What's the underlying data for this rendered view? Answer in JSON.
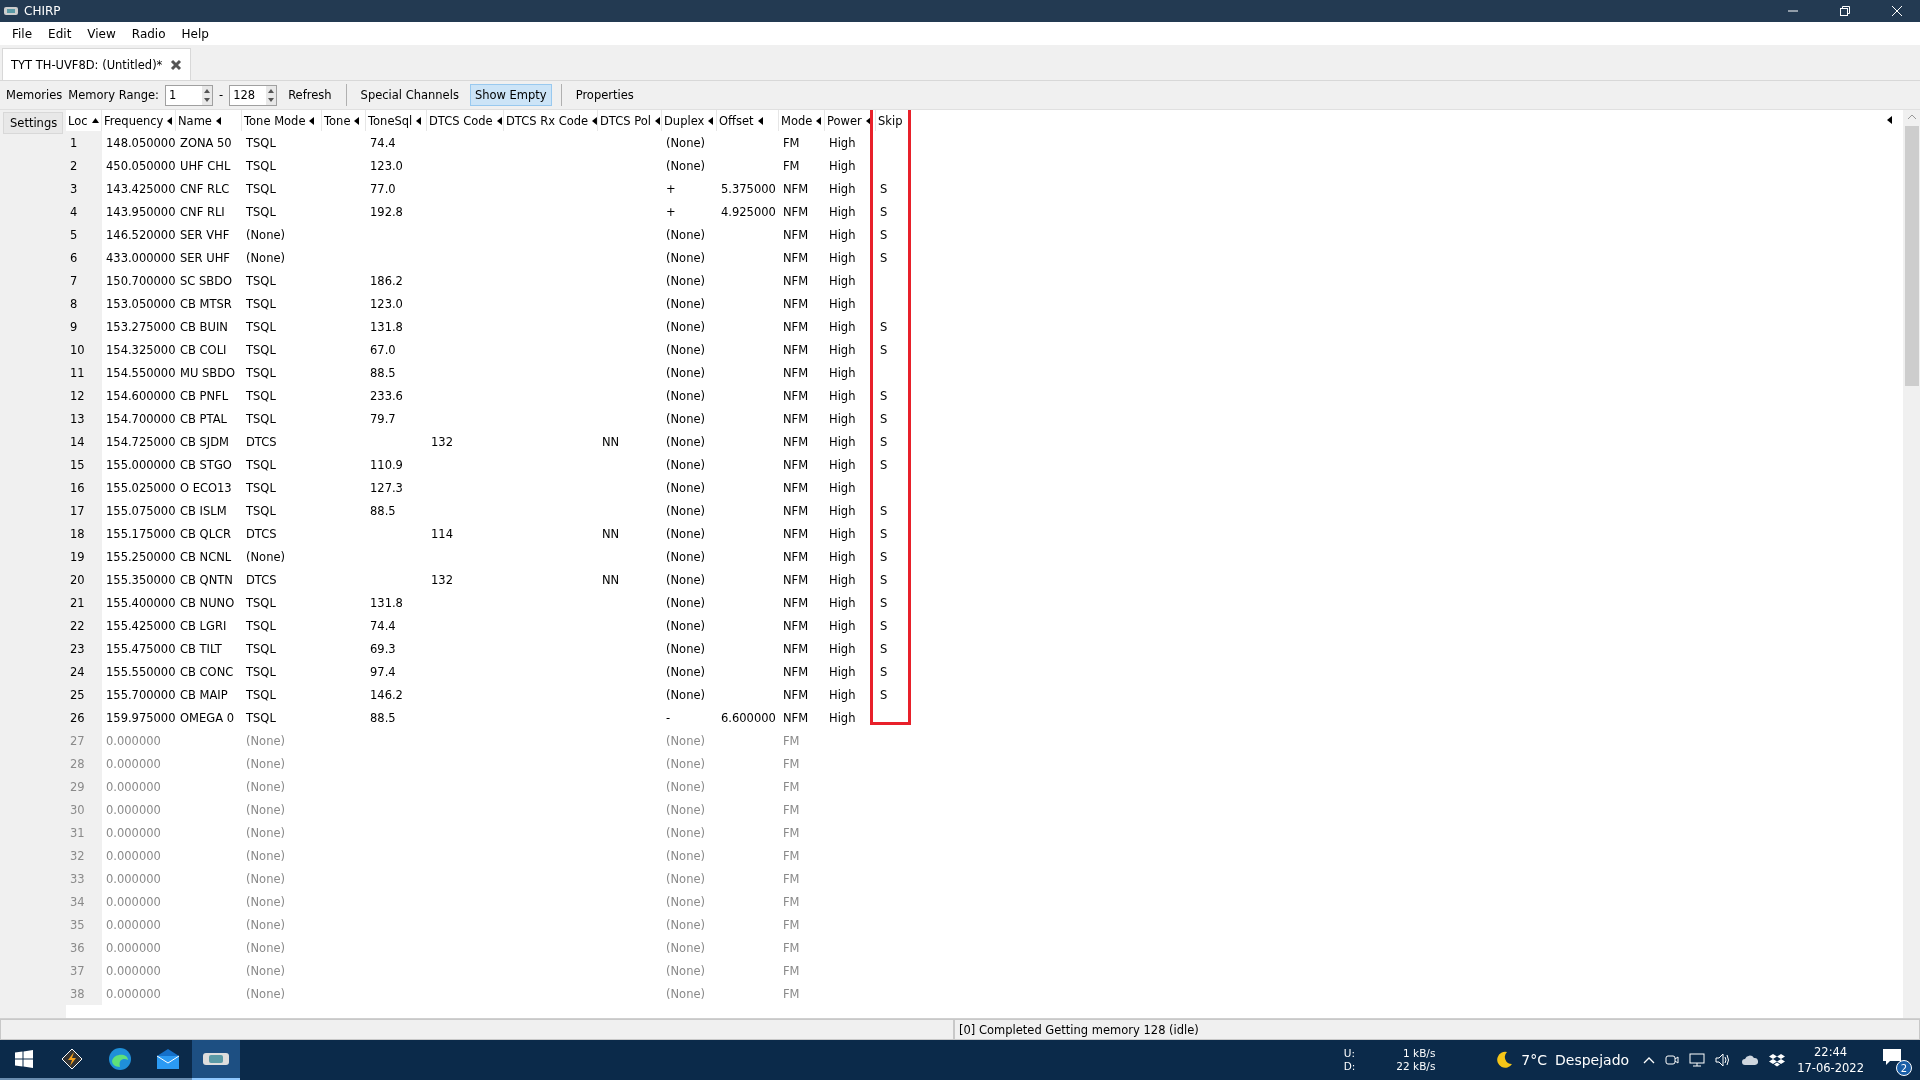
{
  "window": {
    "title": "CHIRP"
  },
  "menu": [
    "File",
    "Edit",
    "View",
    "Radio",
    "Help"
  ],
  "tabs": [
    {
      "label": "TYT TH-UVF8D: (Untitled)*",
      "selected": true
    }
  ],
  "toolbar": {
    "memories_label": "Memories",
    "range_label": "Memory Range:",
    "range_start": "1",
    "range_separator": "-",
    "range_end": "128",
    "refresh": "Refresh",
    "special_channels": "Special Channels",
    "show_empty": {
      "label": "Show Empty",
      "on": true
    },
    "properties": "Properties"
  },
  "side_tabs": [
    {
      "label": "Settings",
      "selected": false
    }
  ],
  "table": {
    "columns": [
      {
        "label": "Loc",
        "sorted": true,
        "highlighted": false
      },
      {
        "label": "Frequency",
        "sorted": false,
        "highlighted": false
      },
      {
        "label": "Name",
        "sorted": false,
        "highlighted": false
      },
      {
        "label": "Tone Mode",
        "sorted": false,
        "highlighted": false
      },
      {
        "label": "Tone",
        "sorted": false,
        "highlighted": false
      },
      {
        "label": "ToneSql",
        "sorted": false,
        "highlighted": false
      },
      {
        "label": "DTCS Code",
        "sorted": false,
        "highlighted": false
      },
      {
        "label": "DTCS Rx Code",
        "sorted": false,
        "highlighted": false
      },
      {
        "label": "DTCS Pol",
        "sorted": false,
        "highlighted": false
      },
      {
        "label": "Duplex",
        "sorted": false,
        "highlighted": false
      },
      {
        "label": "Offset",
        "sorted": false,
        "highlighted": false
      },
      {
        "label": "Mode",
        "sorted": false,
        "highlighted": false
      },
      {
        "label": "Power",
        "sorted": false,
        "highlighted": false
      },
      {
        "label": "Skip",
        "highlighted": true
      }
    ],
    "rows": [
      {
        "empty": false,
        "cells": [
          "1",
          "148.050000",
          "ZONA 50",
          "TSQL",
          null,
          "74.4",
          null,
          null,
          null,
          "(None)",
          null,
          "FM",
          "High",
          null
        ]
      },
      {
        "empty": false,
        "cells": [
          "2",
          "450.050000",
          "UHF CHL",
          "TSQL",
          null,
          "123.0",
          null,
          null,
          null,
          "(None)",
          null,
          "FM",
          "High",
          null
        ]
      },
      {
        "empty": false,
        "cells": [
          "3",
          "143.425000",
          "CNF RLC",
          "TSQL",
          null,
          "77.0",
          null,
          null,
          null,
          "+",
          "5.375000",
          "NFM",
          "High",
          "S"
        ]
      },
      {
        "empty": false,
        "cells": [
          "4",
          "143.950000",
          "CNF RLI",
          "TSQL",
          null,
          "192.8",
          null,
          null,
          null,
          "+",
          "4.925000",
          "NFM",
          "High",
          "S"
        ]
      },
      {
        "empty": false,
        "cells": [
          "5",
          "146.520000",
          "SER VHF",
          "(None)",
          null,
          null,
          null,
          null,
          null,
          "(None)",
          null,
          "NFM",
          "High",
          "S"
        ]
      },
      {
        "empty": false,
        "cells": [
          "6",
          "433.000000",
          "SER UHF",
          "(None)",
          null,
          null,
          null,
          null,
          null,
          "(None)",
          null,
          "NFM",
          "High",
          "S"
        ]
      },
      {
        "empty": false,
        "cells": [
          "7",
          "150.700000",
          "SC SBDO",
          "TSQL",
          null,
          "186.2",
          null,
          null,
          null,
          "(None)",
          null,
          "NFM",
          "High",
          null
        ]
      },
      {
        "empty": false,
        "cells": [
          "8",
          "153.050000",
          "CB MTSR",
          "TSQL",
          null,
          "123.0",
          null,
          null,
          null,
          "(None)",
          null,
          "NFM",
          "High",
          null
        ]
      },
      {
        "empty": false,
        "cells": [
          "9",
          "153.275000",
          "CB BUIN",
          "TSQL",
          null,
          "131.8",
          null,
          null,
          null,
          "(None)",
          null,
          "NFM",
          "High",
          "S"
        ]
      },
      {
        "empty": false,
        "cells": [
          "10",
          "154.325000",
          "CB COLI",
          "TSQL",
          null,
          "67.0",
          null,
          null,
          null,
          "(None)",
          null,
          "NFM",
          "High",
          "S"
        ]
      },
      {
        "empty": false,
        "cells": [
          "11",
          "154.550000",
          "MU SBDO",
          "TSQL",
          null,
          "88.5",
          null,
          null,
          null,
          "(None)",
          null,
          "NFM",
          "High",
          null
        ]
      },
      {
        "empty": false,
        "cells": [
          "12",
          "154.600000",
          "CB PNFL",
          "TSQL",
          null,
          "233.6",
          null,
          null,
          null,
          "(None)",
          null,
          "NFM",
          "High",
          "S"
        ]
      },
      {
        "empty": false,
        "cells": [
          "13",
          "154.700000",
          "CB PTAL",
          "TSQL",
          null,
          "79.7",
          null,
          null,
          null,
          "(None)",
          null,
          "NFM",
          "High",
          "S"
        ]
      },
      {
        "empty": false,
        "cells": [
          "14",
          "154.725000",
          "CB SJDM",
          "DTCS",
          null,
          null,
          "132",
          null,
          "NN",
          "(None)",
          null,
          "NFM",
          "High",
          "S"
        ]
      },
      {
        "empty": false,
        "cells": [
          "15",
          "155.000000",
          "CB STGO",
          "TSQL",
          null,
          "110.9",
          null,
          null,
          null,
          "(None)",
          null,
          "NFM",
          "High",
          "S"
        ]
      },
      {
        "empty": false,
        "cells": [
          "16",
          "155.025000",
          "O ECO13",
          "TSQL",
          null,
          "127.3",
          null,
          null,
          null,
          "(None)",
          null,
          "NFM",
          "High",
          null
        ]
      },
      {
        "empty": false,
        "cells": [
          "17",
          "155.075000",
          "CB ISLM",
          "TSQL",
          null,
          "88.5",
          null,
          null,
          null,
          "(None)",
          null,
          "NFM",
          "High",
          "S"
        ]
      },
      {
        "empty": false,
        "cells": [
          "18",
          "155.175000",
          "CB QLCR",
          "DTCS",
          null,
          null,
          "114",
          null,
          "NN",
          "(None)",
          null,
          "NFM",
          "High",
          "S"
        ]
      },
      {
        "empty": false,
        "cells": [
          "19",
          "155.250000",
          "CB NCNL",
          "(None)",
          null,
          null,
          null,
          null,
          null,
          "(None)",
          null,
          "NFM",
          "High",
          "S"
        ]
      },
      {
        "empty": false,
        "cells": [
          "20",
          "155.350000",
          "CB QNTN",
          "DTCS",
          null,
          null,
          "132",
          null,
          "NN",
          "(None)",
          null,
          "NFM",
          "High",
          "S"
        ]
      },
      {
        "empty": false,
        "cells": [
          "21",
          "155.400000",
          "CB NUNO",
          "TSQL",
          null,
          "131.8",
          null,
          null,
          null,
          "(None)",
          null,
          "NFM",
          "High",
          "S"
        ]
      },
      {
        "empty": false,
        "cells": [
          "22",
          "155.425000",
          "CB LGRI",
          "TSQL",
          null,
          "74.4",
          null,
          null,
          null,
          "(None)",
          null,
          "NFM",
          "High",
          "S"
        ]
      },
      {
        "empty": false,
        "cells": [
          "23",
          "155.475000",
          "CB TILT",
          "TSQL",
          null,
          "69.3",
          null,
          null,
          null,
          "(None)",
          null,
          "NFM",
          "High",
          "S"
        ]
      },
      {
        "empty": false,
        "cells": [
          "24",
          "155.550000",
          "CB CONC",
          "TSQL",
          null,
          "97.4",
          null,
          null,
          null,
          "(None)",
          null,
          "NFM",
          "High",
          "S"
        ]
      },
      {
        "empty": false,
        "cells": [
          "25",
          "155.700000",
          "CB MAIP",
          "TSQL",
          null,
          "146.2",
          null,
          null,
          null,
          "(None)",
          null,
          "NFM",
          "High",
          "S"
        ]
      },
      {
        "empty": false,
        "cells": [
          "26",
          "159.975000",
          "OMEGA 0",
          "TSQL",
          null,
          "88.5",
          null,
          null,
          null,
          "-",
          "6.600000",
          "NFM",
          "High",
          null
        ]
      },
      {
        "empty": true,
        "cells": [
          "27",
          "0.000000",
          null,
          "(None)",
          null,
          null,
          null,
          null,
          null,
          "(None)",
          null,
          "FM",
          null,
          null
        ]
      },
      {
        "empty": true,
        "cells": [
          "28",
          "0.000000",
          null,
          "(None)",
          null,
          null,
          null,
          null,
          null,
          "(None)",
          null,
          "FM",
          null,
          null
        ]
      },
      {
        "empty": true,
        "cells": [
          "29",
          "0.000000",
          null,
          "(None)",
          null,
          null,
          null,
          null,
          null,
          "(None)",
          null,
          "FM",
          null,
          null
        ]
      },
      {
        "empty": true,
        "cells": [
          "30",
          "0.000000",
          null,
          "(None)",
          null,
          null,
          null,
          null,
          null,
          "(None)",
          null,
          "FM",
          null,
          null
        ]
      },
      {
        "empty": true,
        "cells": [
          "31",
          "0.000000",
          null,
          "(None)",
          null,
          null,
          null,
          null,
          null,
          "(None)",
          null,
          "FM",
          null,
          null
        ]
      },
      {
        "empty": true,
        "cells": [
          "32",
          "0.000000",
          null,
          "(None)",
          null,
          null,
          null,
          null,
          null,
          "(None)",
          null,
          "FM",
          null,
          null
        ]
      },
      {
        "empty": true,
        "cells": [
          "33",
          "0.000000",
          null,
          "(None)",
          null,
          null,
          null,
          null,
          null,
          "(None)",
          null,
          "FM",
          null,
          null
        ]
      },
      {
        "empty": true,
        "cells": [
          "34",
          "0.000000",
          null,
          "(None)",
          null,
          null,
          null,
          null,
          null,
          "(None)",
          null,
          "FM",
          null,
          null
        ]
      },
      {
        "empty": true,
        "cells": [
          "35",
          "0.000000",
          null,
          "(None)",
          null,
          null,
          null,
          null,
          null,
          "(None)",
          null,
          "FM",
          null,
          null
        ]
      },
      {
        "empty": true,
        "cells": [
          "36",
          "0.000000",
          null,
          "(None)",
          null,
          null,
          null,
          null,
          null,
          "(None)",
          null,
          "FM",
          null,
          null
        ]
      },
      {
        "empty": true,
        "cells": [
          "37",
          "0.000000",
          null,
          "(None)",
          null,
          null,
          null,
          null,
          null,
          "(None)",
          null,
          "FM",
          null,
          null
        ]
      },
      {
        "empty": true,
        "cells": [
          "38",
          "0.000000",
          null,
          "(None)",
          null,
          null,
          null,
          null,
          null,
          "(None)",
          null,
          "FM",
          null,
          null
        ]
      }
    ]
  },
  "status_bar": {
    "message": "[0] Completed Getting memory 128 (idle)"
  },
  "taskbar": {
    "apps": [
      {
        "kind": "bolt",
        "active": false
      },
      {
        "kind": "browser",
        "active": false
      },
      {
        "kind": "mail",
        "active": false
      },
      {
        "kind": "serial",
        "active": true
      }
    ],
    "net_up_label": "U:",
    "net_up": "1 kB/s",
    "net_down_label": "D:",
    "net_down": "22 kB/s",
    "weather_temp": "7°C",
    "weather_text": "Despejado",
    "time": "22:44",
    "date": "17-06-2022",
    "notifications": "2"
  }
}
